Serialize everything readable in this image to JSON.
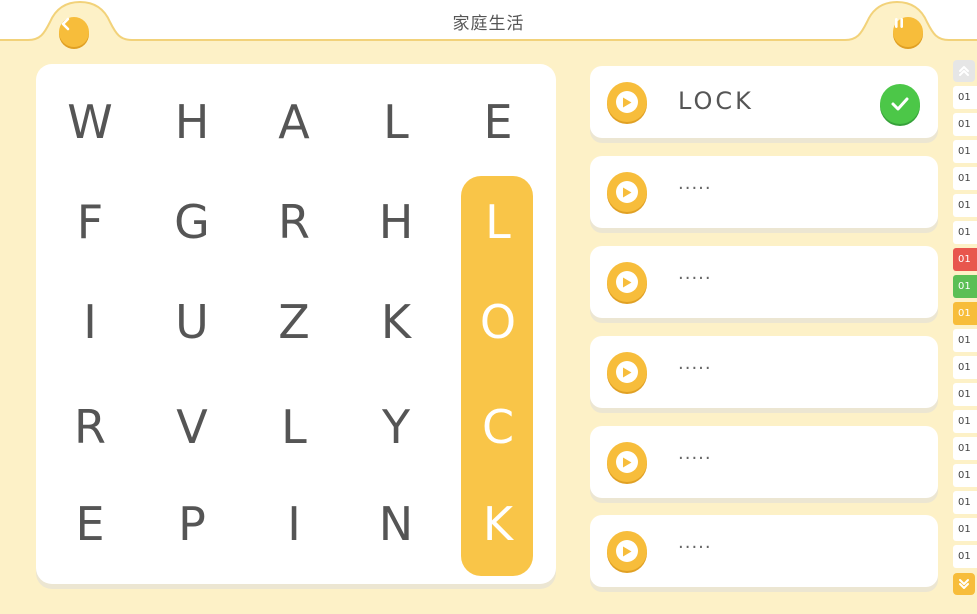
{
  "header": {
    "title": "家庭生活"
  },
  "grid": {
    "rows": [
      [
        "W",
        "H",
        "A",
        "L",
        "E"
      ],
      [
        "F",
        "G",
        "R",
        "H",
        "L"
      ],
      [
        "I",
        "U",
        "Z",
        "K",
        "O"
      ],
      [
        "R",
        "V",
        "L",
        "Y",
        "C"
      ],
      [
        "E",
        "P",
        "I",
        "N",
        "K"
      ]
    ]
  },
  "words": [
    {
      "text": "LOCK",
      "found": true
    },
    {
      "text": "·····",
      "found": false
    },
    {
      "text": "·····",
      "found": false
    },
    {
      "text": "·····",
      "found": false
    },
    {
      "text": "·····",
      "found": false
    },
    {
      "text": "·····",
      "found": false
    }
  ],
  "levels": {
    "items": [
      {
        "label": "01",
        "state": "default"
      },
      {
        "label": "01",
        "state": "default"
      },
      {
        "label": "01",
        "state": "default"
      },
      {
        "label": "01",
        "state": "default"
      },
      {
        "label": "01",
        "state": "default"
      },
      {
        "label": "01",
        "state": "default"
      },
      {
        "label": "01",
        "state": "error"
      },
      {
        "label": "01",
        "state": "success"
      },
      {
        "label": "01",
        "state": "current"
      },
      {
        "label": "01",
        "state": "default"
      },
      {
        "label": "01",
        "state": "default"
      },
      {
        "label": "01",
        "state": "default"
      },
      {
        "label": "01",
        "state": "default"
      },
      {
        "label": "01",
        "state": "default"
      },
      {
        "label": "01",
        "state": "default"
      },
      {
        "label": "01",
        "state": "default"
      },
      {
        "label": "01",
        "state": "default"
      },
      {
        "label": "01",
        "state": "default"
      }
    ]
  },
  "colors": {
    "background": "#fdf1c7",
    "accent": "#f7bd3b",
    "highlight": "#f9c548",
    "success": "#4cc748",
    "error": "#e8564d"
  },
  "icons": {
    "back": "chevron-left-icon",
    "pause": "pause-icon",
    "play": "play-icon",
    "check": "check-icon",
    "scroll_up": "double-chevron-up-icon",
    "scroll_down": "double-chevron-down-icon"
  }
}
